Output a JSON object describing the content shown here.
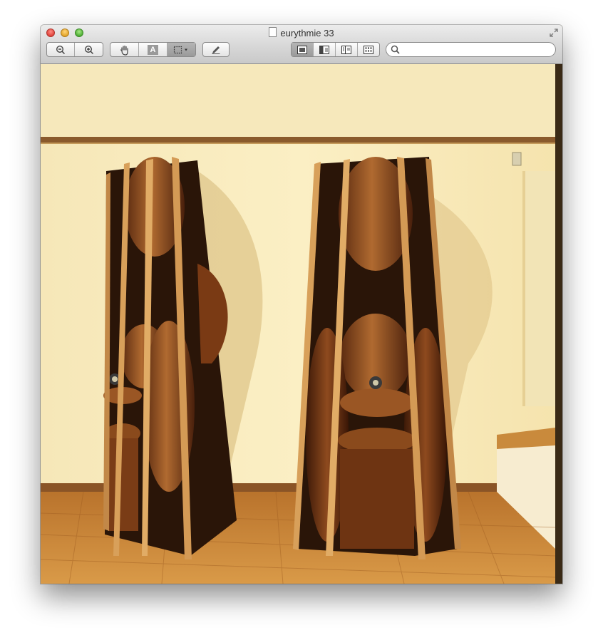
{
  "window": {
    "title": "eurythmie 33"
  },
  "toolbar": {
    "text_tool_label": "A",
    "search_placeholder": "",
    "search_value": ""
  },
  "image": {
    "subject": "photograph"
  }
}
